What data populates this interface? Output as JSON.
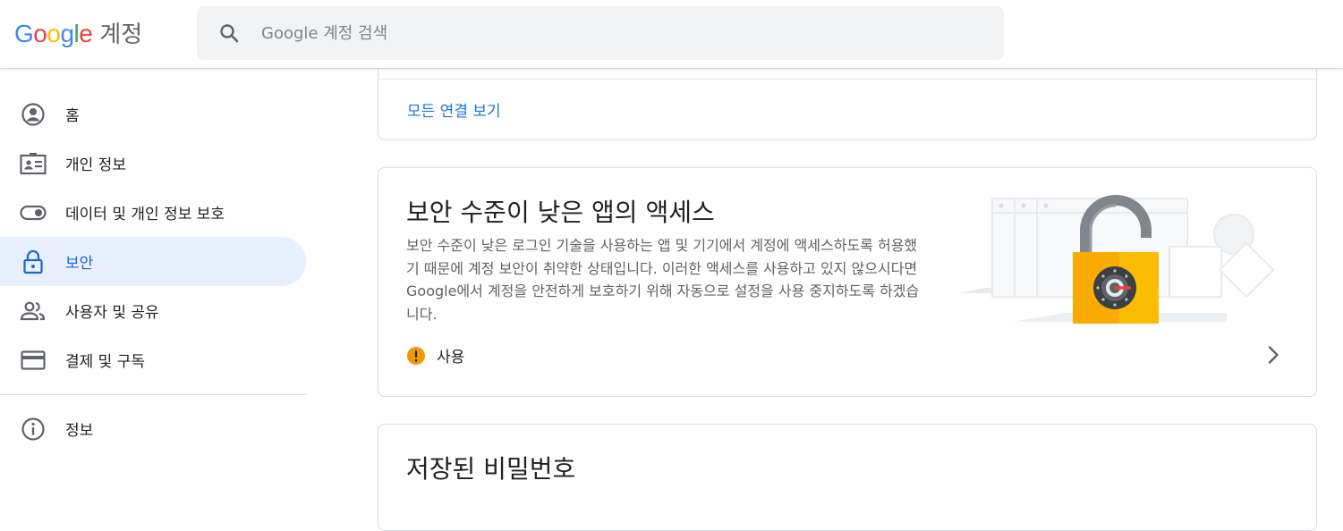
{
  "header": {
    "logo_letters": [
      "G",
      "o",
      "o",
      "g",
      "l",
      "e"
    ],
    "product": "계정",
    "search_placeholder": "Google 계정 검색"
  },
  "sidebar": {
    "items": [
      {
        "label": "홈",
        "icon": "account-circle-icon",
        "active": false
      },
      {
        "label": "개인 정보",
        "icon": "id-card-icon",
        "active": false
      },
      {
        "label": "데이터 및 개인 정보 보호",
        "icon": "toggle-icon",
        "active": false
      },
      {
        "label": "보안",
        "icon": "lock-icon",
        "active": true
      },
      {
        "label": "사용자 및 공유",
        "icon": "people-icon",
        "active": false
      },
      {
        "label": "결제 및 구독",
        "icon": "credit-card-icon",
        "active": false
      }
    ],
    "info_item": {
      "label": "정보",
      "icon": "info-icon"
    }
  },
  "connections_card": {
    "link": "모든 연결 보기"
  },
  "less_secure_card": {
    "title": "보안 수준이 낮은 앱의 액세스",
    "description": "보안 수준이 낮은 로그인 기술을 사용하는 앱 및 기기에서 계정에 액세스하도록 허용했기 때문에 계정 보안이 취약한 상태입니다. 이러한 액세스를 사용하고 있지 않으시다면 Google에서 계정을 안전하게 보호하기 위해 자동으로 설정을 사용 중지하도록 하겠습니다.",
    "status": "사용",
    "status_icon": "warning-icon",
    "status_color": "#f29900",
    "illustration": "open-padlock-illustration"
  },
  "passwords_card": {
    "title": "저장된 비밀번호"
  },
  "colors": {
    "accent": "#1a73e8",
    "active_bg": "#e8f0fe",
    "active_text": "#1967d2"
  }
}
